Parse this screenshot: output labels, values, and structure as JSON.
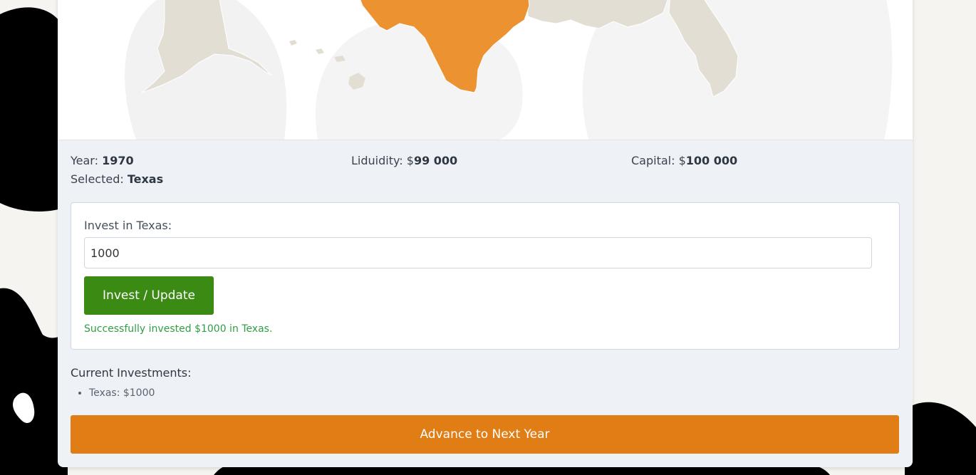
{
  "colors": {
    "selected_state": "#ec9231",
    "unselected_state": "#e3ded4",
    "invest_button": "#3b8a14",
    "advance_button": "#e07d14",
    "success_text": "#2f9e44"
  },
  "stats": {
    "year_label": "Year: ",
    "year_value": "1970",
    "liquidity_label": "Liduidity: $",
    "liquidity_value": "99 000",
    "capital_label": "Capital: $",
    "capital_value": "100 000",
    "selected_label": "Selected: ",
    "selected_value": "Texas"
  },
  "invest_form": {
    "label": "Invest in Texas:",
    "input_value": "1000",
    "button_label": "Invest / Update",
    "success_message": "Successfully invested $1000 in Texas."
  },
  "investments": {
    "title": "Current Investments:",
    "items": [
      "Texas: $1000"
    ]
  },
  "advance_button_label": "Advance to Next Year"
}
